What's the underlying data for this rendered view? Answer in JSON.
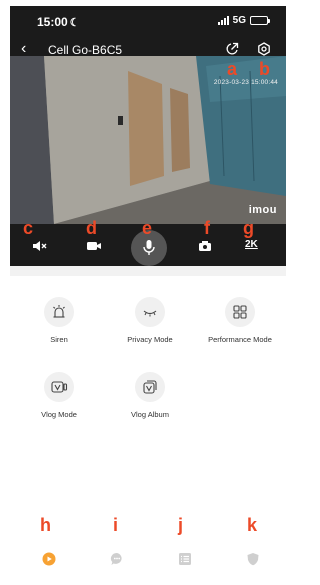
{
  "status_bar": {
    "time": "15:00",
    "network": "5G"
  },
  "nav": {
    "title": "Cell Go-B6C5"
  },
  "video": {
    "timestamp": "2023-03-23 15:00:44",
    "brand": "imou"
  },
  "controls": {
    "resolution": "2K"
  },
  "markers": {
    "a": "a",
    "b": "b",
    "c": "c",
    "d": "d",
    "e": "e",
    "f": "f",
    "g": "g",
    "h": "h",
    "i": "i",
    "j": "j",
    "k": "k"
  },
  "features": [
    {
      "label": "Siren",
      "icon": "siren-icon"
    },
    {
      "label": "Privacy Mode",
      "icon": "closed-eye-icon"
    },
    {
      "label": "Performance Mode",
      "icon": "grid-icon"
    },
    {
      "label": "Vlog Mode",
      "icon": "vlog-camera-icon"
    },
    {
      "label": "Vlog Album",
      "icon": "vlog-album-icon"
    }
  ],
  "bottom_tabs": [
    {
      "name": "live",
      "icon": "play-icon",
      "active": true
    },
    {
      "name": "messages",
      "icon": "message-icon",
      "active": false
    },
    {
      "name": "list",
      "icon": "list-icon",
      "active": false
    },
    {
      "name": "security",
      "icon": "shield-icon",
      "active": false
    }
  ],
  "colors": {
    "accent": "#f7a233",
    "marker": "#ec4a28",
    "inactive_tab": "#cfcfcf",
    "dark_bg": "#1b1b1b"
  }
}
